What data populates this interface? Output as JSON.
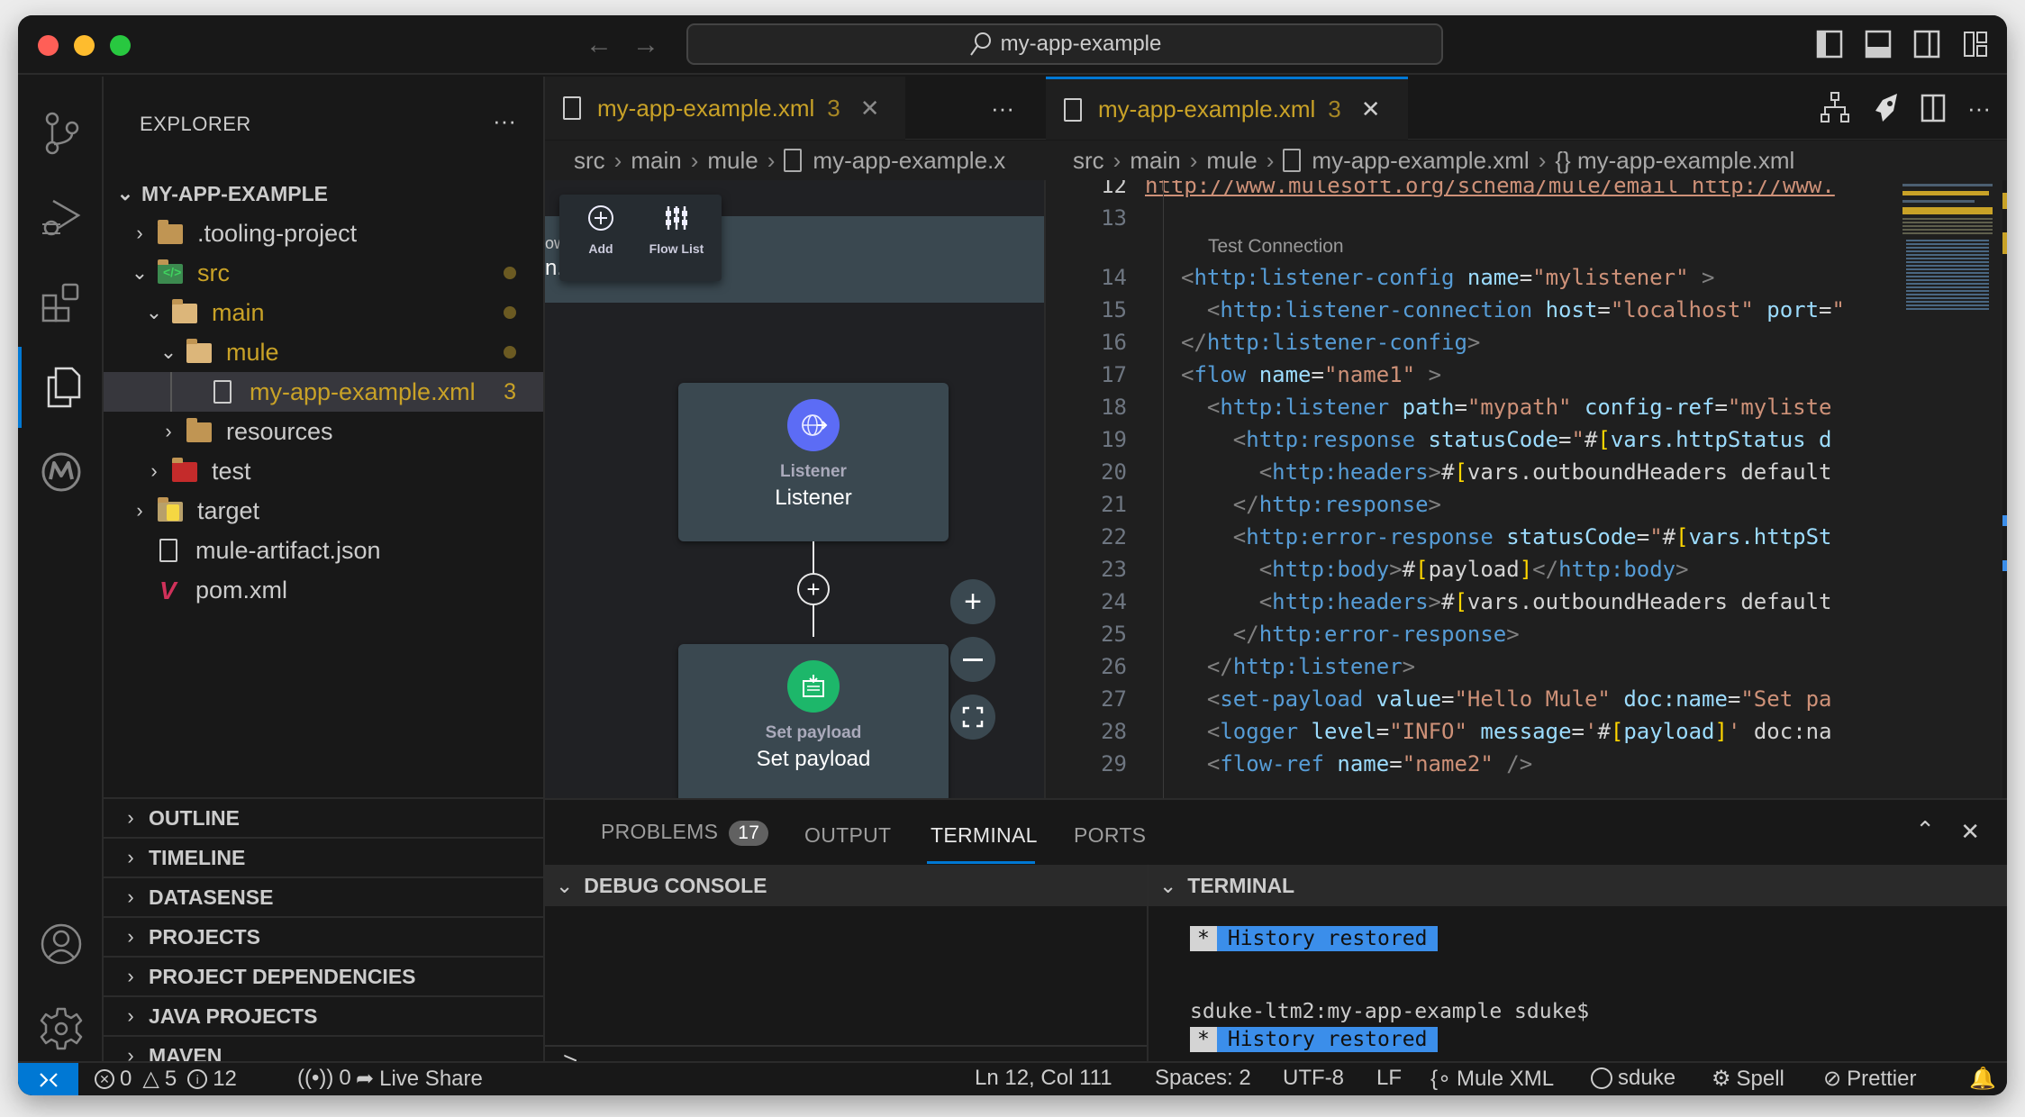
{
  "titlebar": {
    "search_text": "my-app-example",
    "back_icon": "arrow-left-icon",
    "forward_icon": "arrow-right-icon",
    "layout_icons": [
      "toggle-primary-sidebar-icon",
      "toggle-panel-icon",
      "toggle-secondary-sidebar-icon",
      "customize-layout-icon"
    ]
  },
  "activity_bar": {
    "items": [
      {
        "name": "source-control",
        "icon": "source-control-icon"
      },
      {
        "name": "run-and-debug",
        "icon": "debug-icon"
      },
      {
        "name": "extensions",
        "icon": "extensions-icon"
      },
      {
        "name": "explorer",
        "icon": "files-icon",
        "active": true
      },
      {
        "name": "mulesoft",
        "icon": "mulesoft-icon"
      }
    ],
    "bottom": [
      {
        "name": "accounts",
        "icon": "account-icon"
      },
      {
        "name": "manage",
        "icon": "gear-icon"
      }
    ]
  },
  "sidebar": {
    "title": "EXPLORER",
    "more": "···",
    "root": "MY-APP-EXAMPLE",
    "tree": [
      {
        "label": ".tooling-project",
        "type": "folder",
        "expanded": false,
        "modified": false
      },
      {
        "label": "src",
        "type": "folder-src",
        "expanded": true,
        "modified": true
      },
      {
        "label": "main",
        "type": "folder",
        "expanded": true,
        "modified": true
      },
      {
        "label": "mule",
        "type": "folder",
        "expanded": true,
        "modified": true
      },
      {
        "label": "my-app-example.xml",
        "type": "file",
        "problems": "3",
        "selected": true
      },
      {
        "label": "resources",
        "type": "folder",
        "expanded": false
      },
      {
        "label": "test",
        "type": "folder-test",
        "expanded": false
      },
      {
        "label": "target",
        "type": "folder-target",
        "expanded": false
      },
      {
        "label": "mule-artifact.json",
        "type": "file"
      },
      {
        "label": "pom.xml",
        "type": "maven-file"
      }
    ],
    "sections": [
      "OUTLINE",
      "TIMELINE",
      "DATASENSE",
      "PROJECTS",
      "PROJECT DEPENDENCIES",
      "JAVA PROJECTS",
      "MAVEN"
    ]
  },
  "left_editor": {
    "tab": {
      "label": "my-app-example.xml",
      "problems": "3"
    },
    "more": "···",
    "breadcrumb": [
      "src",
      "main",
      "mule",
      "my-app-example.x"
    ],
    "toolbar": {
      "add_label": "Add",
      "flow_list_label": "Flow List"
    },
    "banner_partial": [
      "ow",
      "n..."
    ],
    "nodes": [
      {
        "subtitle": "Listener",
        "title": "Listener",
        "icon": "globe-icon",
        "color": "#5c6cf5"
      },
      {
        "subtitle": "Set payload",
        "title": "Set payload",
        "icon": "set-payload-icon",
        "color": "#1db76a"
      }
    ],
    "zoom_controls": [
      "+",
      "−",
      "fit"
    ]
  },
  "right_editor": {
    "tab": {
      "label": "my-app-example.xml",
      "problems": "3"
    },
    "actions": [
      "flow-diagram-icon",
      "deploy-rocket-icon",
      "split-editor-icon",
      "more-actions-icon"
    ],
    "breadcrumb": [
      "src",
      "main",
      "mule",
      "my-app-example.xml",
      "{} my-app-example.xml"
    ],
    "codelens": "Test Connection",
    "lines": [
      {
        "n": "12",
        "text": "http://www.mulesoft.org/schema/mule/email http://www.",
        "current": true
      },
      {
        "n": "13",
        "text": ""
      },
      {
        "n": "14",
        "text": "<http:listener-config name=\"mylistener\" >"
      },
      {
        "n": "15",
        "text": "  <http:listener-connection host=\"localhost\" port=\""
      },
      {
        "n": "16",
        "text": "</http:listener-config>"
      },
      {
        "n": "17",
        "text": "<flow name=\"name1\" >"
      },
      {
        "n": "18",
        "text": "  <http:listener path=\"mypath\" config-ref=\"myliste"
      },
      {
        "n": "19",
        "text": "    <http:response statusCode=\"#[vars.httpStatus d"
      },
      {
        "n": "20",
        "text": "      <http:headers>#[vars.outboundHeaders default"
      },
      {
        "n": "21",
        "text": "    </http:response>"
      },
      {
        "n": "22",
        "text": "    <http:error-response statusCode=\"#[vars.httpSt"
      },
      {
        "n": "23",
        "text": "      <http:body>#[payload]</http:body>"
      },
      {
        "n": "24",
        "text": "      <http:headers>#[vars.outboundHeaders default"
      },
      {
        "n": "25",
        "text": "    </http:error-response>"
      },
      {
        "n": "26",
        "text": "  </http:listener>"
      },
      {
        "n": "27",
        "text": "  <set-payload value=\"Hello Mule\" doc:name=\"Set pa"
      },
      {
        "n": "28",
        "text": "  <logger level=\"INFO\" message='#[payload]' doc:na"
      },
      {
        "n": "29",
        "text": "  <flow-ref name=\"name2\" />"
      }
    ]
  },
  "panel": {
    "tabs": [
      {
        "label": "PROBLEMS",
        "badge": "17"
      },
      {
        "label": "OUTPUT"
      },
      {
        "label": "TERMINAL",
        "active": true
      },
      {
        "label": "PORTS"
      }
    ],
    "debug_console_title": "DEBUG CONSOLE",
    "debug_prompt": ">",
    "terminal_title": "TERMINAL",
    "terminal": {
      "history_star": "*",
      "history_text": "History restored",
      "prompt": "sduke-ltm2:my-app-example sduke$"
    },
    "maximize_icon": "chevron-up-icon",
    "close_icon": "close-icon"
  },
  "statusbar": {
    "errors": "0",
    "warnings": "5",
    "infos": "12",
    "ports": "0",
    "live_share": "Live Share",
    "position": "Ln 12, Col 111",
    "spaces": "Spaces: 2",
    "encoding": "UTF-8",
    "eol": "LF",
    "language": "Mule XML",
    "user": "sduke",
    "spell": "Spell",
    "prettier": "Prettier"
  },
  "colors": {
    "accent": "#0078d4",
    "modified": "#c9a227",
    "terminal_highlight": "#3b8eea"
  }
}
